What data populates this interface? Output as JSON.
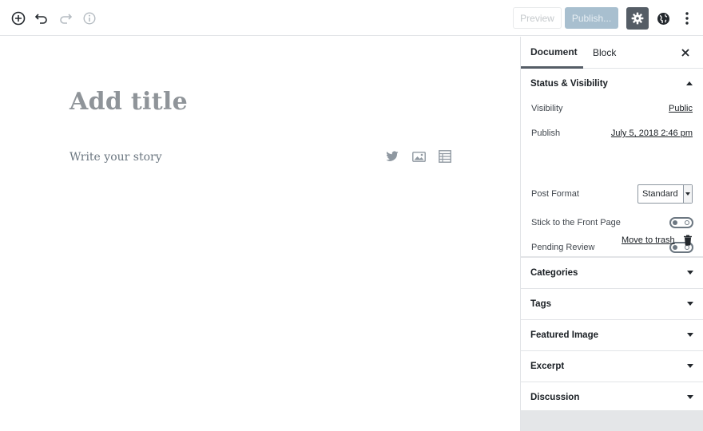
{
  "toolbar": {
    "preview_label": "Preview",
    "publish_label": "Publish...",
    "icons": [
      "add-block-icon",
      "undo-icon",
      "redo-icon",
      "info-icon",
      "gear-icon",
      "globe-icon",
      "more-vertical-icon"
    ]
  },
  "editor": {
    "title_placeholder": "Add title",
    "body_placeholder": "Write your story",
    "inserter_icons": [
      "twitter-icon",
      "image-icon",
      "table-icon"
    ]
  },
  "sidebar": {
    "tabs": [
      "Document",
      "Block"
    ],
    "status_panel": {
      "title": "Status & Visibility",
      "visibility_label": "Visibility",
      "visibility_value": "Public",
      "publish_label": "Publish",
      "publish_value": "July 5, 2018 2:46 pm",
      "post_format_label": "Post Format",
      "post_format_value": "Standard",
      "sticky_label": "Stick to the Front Page",
      "pending_label": "Pending Review",
      "trash_label": "Move to trash"
    },
    "panels": [
      "Categories",
      "Tags",
      "Featured Image",
      "Excerpt",
      "Discussion"
    ]
  },
  "colors": {
    "publish_button": "#a8bfcf",
    "settings_button": "#555d66",
    "title_placeholder": "#8f9499"
  }
}
